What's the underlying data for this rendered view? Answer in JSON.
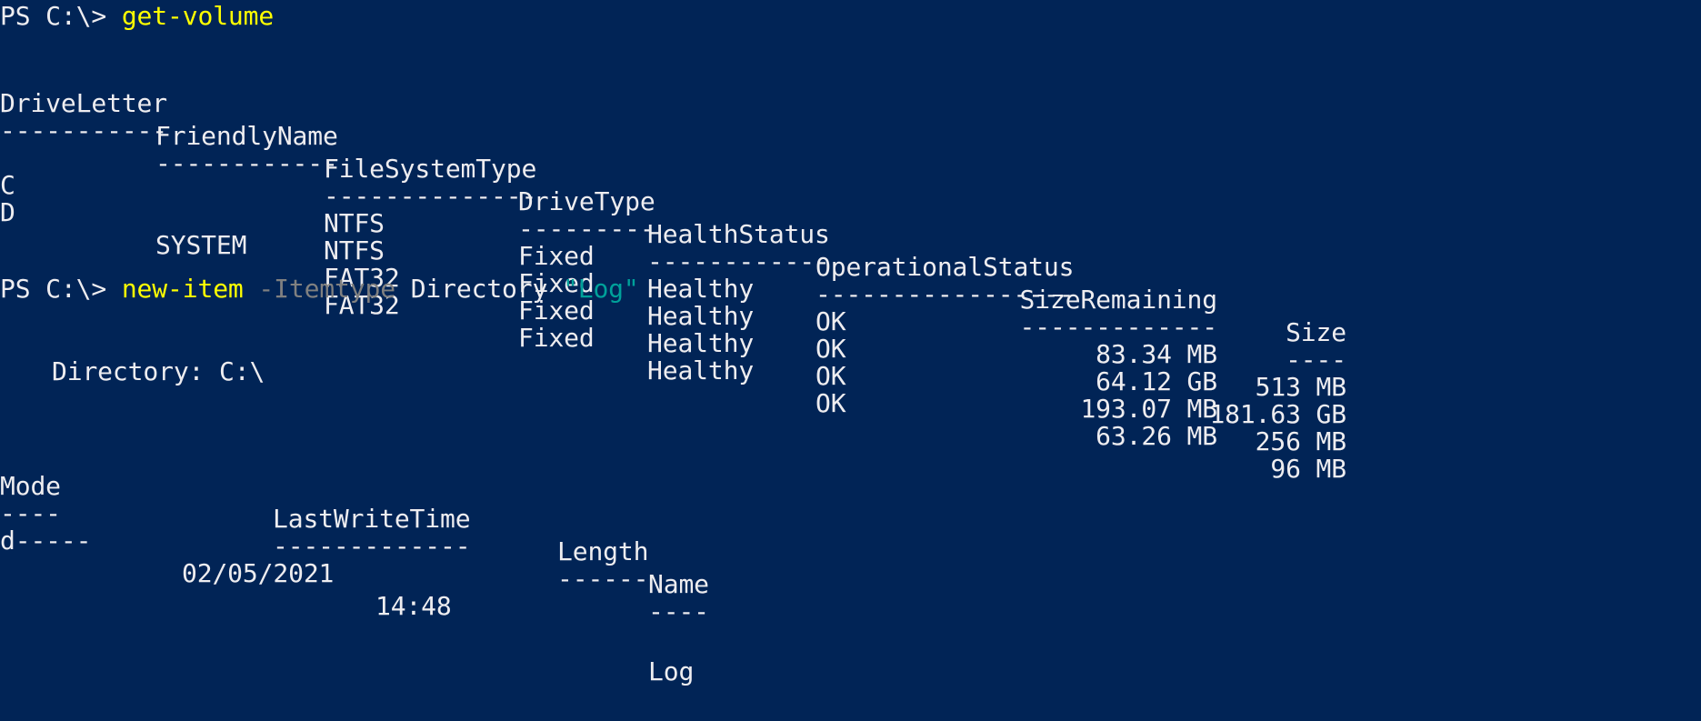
{
  "prompt": "PS C:\\>",
  "cmd1": {
    "name": "get-volume"
  },
  "volume_table": {
    "headers": {
      "drive_letter": "DriveLetter",
      "friendly_name": "FriendlyName",
      "fs_type": "FileSystemType",
      "drive_type": "DriveType",
      "health": "HealthStatus",
      "op_status": "OperationalStatus",
      "size_remaining": "SizeRemaining",
      "size": "Size"
    },
    "separators": {
      "drive_letter": "-----------",
      "friendly_name": "------------",
      "fs_type": "--------------",
      "drive_type": "---------",
      "health": "------------",
      "op_status": "-----------------",
      "size_remaining": "-------------",
      "size": "----"
    },
    "rows": [
      {
        "drive_letter": "",
        "friendly_name": "",
        "fs_type": "NTFS",
        "drive_type": "Fixed",
        "health": "Healthy",
        "op_status": "OK",
        "size_remaining": "83.34 MB",
        "size": "513 MB"
      },
      {
        "drive_letter": "C",
        "friendly_name": "",
        "fs_type": "NTFS",
        "drive_type": "Fixed",
        "health": "Healthy",
        "op_status": "OK",
        "size_remaining": "64.12 GB",
        "size": "181.63 GB"
      },
      {
        "drive_letter": "D",
        "friendly_name": "SYSTEM",
        "fs_type": "FAT32",
        "drive_type": "Fixed",
        "health": "Healthy",
        "op_status": "OK",
        "size_remaining": "193.07 MB",
        "size": "256 MB"
      },
      {
        "drive_letter": "",
        "friendly_name": "",
        "fs_type": "FAT32",
        "drive_type": "Fixed",
        "health": "Healthy",
        "op_status": "OK",
        "size_remaining": "63.26 MB",
        "size": "96 MB"
      }
    ]
  },
  "cmd2": {
    "name": "new-item",
    "param": "-Itemtype",
    "arg": "Directory",
    "value": "\"Log\""
  },
  "directory": {
    "label": "Directory: C:\\"
  },
  "item_table": {
    "headers": {
      "mode": "Mode",
      "last_write": "LastWriteTime",
      "length": "Length",
      "name": "Name"
    },
    "separators": {
      "mode": "----",
      "last_write": "-------------",
      "length": "------",
      "name": "----"
    },
    "rows": [
      {
        "mode": "d-----",
        "date": "02/05/2021",
        "time": "14:48",
        "length": "",
        "name": "Log"
      }
    ]
  },
  "colors": {
    "background": "#012456",
    "foreground": "#eeedf0",
    "command": "#ffff00",
    "parameter": "#808080",
    "string": "#00a19a"
  }
}
